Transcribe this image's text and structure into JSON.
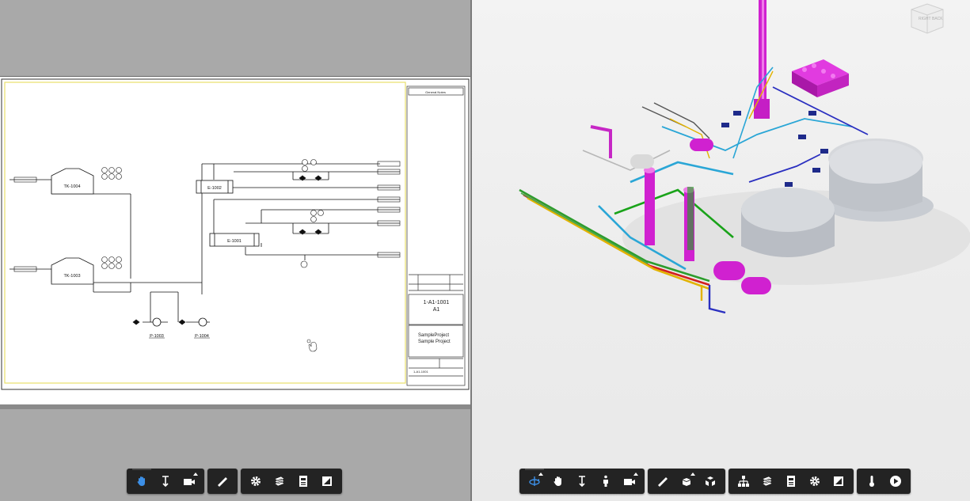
{
  "drawing": {
    "equipment": {
      "tk1004": "TK-1004",
      "tk1003": "TK-1003",
      "e1002": "E-1002",
      "e1001": "E-1001",
      "p1003": "P-1003",
      "p1004": "P-1004"
    },
    "title_block": {
      "header": "General Notes",
      "drawing_number": "1-A1-1001",
      "sheet_size": "A1",
      "project_name": "SampleProject",
      "project_description": "Sample Project",
      "bottom_number": "1-A1-1001"
    }
  },
  "viewcube": {
    "right": "RIGHT",
    "back": "BACK"
  },
  "colors": {
    "selection": "#e040e0",
    "toolbar_bg": "#232323",
    "active_icon": "#3c8fe6",
    "sheet_border": "#e8e06a"
  },
  "left_toolbar": {
    "groups": [
      [
        "pan-icon",
        "zoom-icon",
        "camera-icon"
      ],
      [
        "measure-icon"
      ],
      [
        "settings-icon",
        "layers-icon",
        "properties-icon",
        "fullscreen-icon"
      ]
    ]
  },
  "right_toolbar": {
    "groups": [
      [
        "orbit-icon",
        "pan-icon",
        "zoom-icon",
        "walk-icon",
        "camera-icon"
      ],
      [
        "measure-icon",
        "explode-icon",
        "section-icon"
      ],
      [
        "model-browser-icon",
        "layers-icon",
        "properties-icon",
        "settings-icon",
        "fullscreen-icon"
      ],
      [
        "temperature-icon",
        "play-icon"
      ]
    ]
  }
}
